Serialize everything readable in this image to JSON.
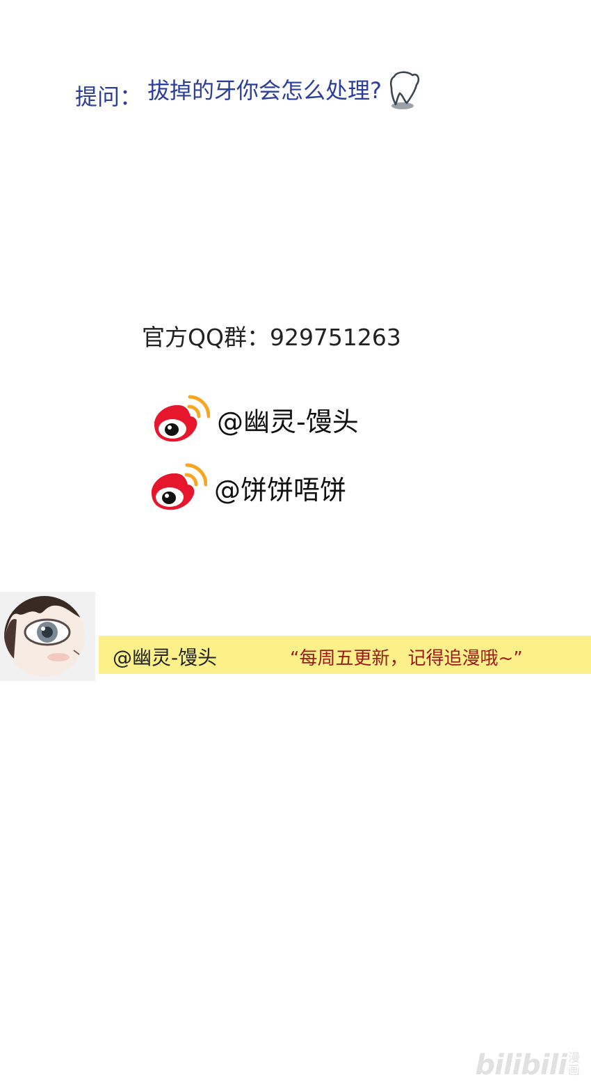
{
  "question": {
    "prefix": "提问：",
    "text": "拔掉的牙你会怎么处理?"
  },
  "qq_group": {
    "label": "官方QQ群：929751263"
  },
  "weibo_accounts": [
    {
      "handle": "@幽灵-馒头",
      "icon": "weibo-logo-icon"
    },
    {
      "handle": "@饼饼唔饼",
      "icon": "weibo-logo-icon"
    }
  ],
  "author_note": {
    "name": "@幽灵-馒头",
    "quote": "“每周五更新，记得追漫哦~”"
  },
  "watermark": {
    "brand": "bilibili",
    "manga_char_1": "漫",
    "manga_char_2": "画"
  },
  "colors": {
    "question_blue": "#2b3f9a",
    "banner_yellow": "#fbf089",
    "quote_red": "#9c1a18",
    "weibo_red": "#e6162d",
    "weibo_orange": "#f5a623"
  }
}
